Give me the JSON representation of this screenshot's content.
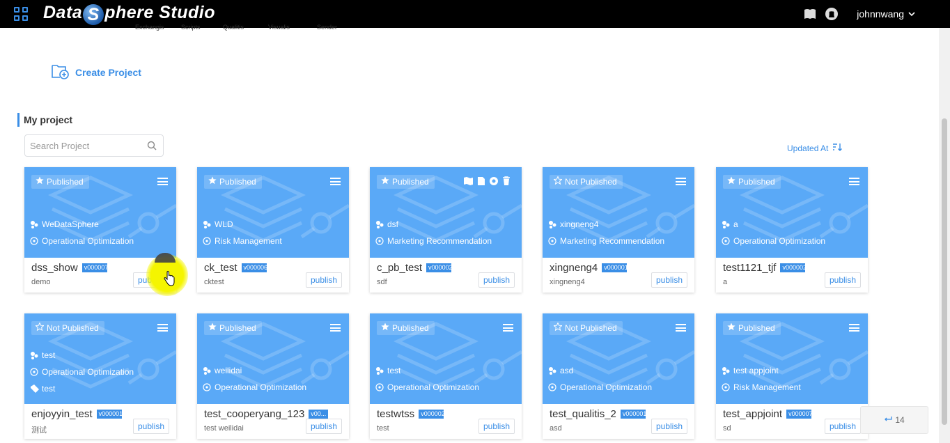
{
  "app": {
    "title_pre": "Data",
    "title_ball": "S",
    "title_post": "phere Studio",
    "user": "johnnwang"
  },
  "subnav": [
    "Exchangis",
    "Scripts",
    "Qualitis",
    "Visualis",
    "Sender"
  ],
  "create_label": "Create Project",
  "section_title": "My project",
  "search": {
    "placeholder": "Search Project"
  },
  "sort_label": "Updated At",
  "publish_label": "publish",
  "float_label": "14",
  "colors": {
    "accent": "#3a8ee6",
    "card_top": "#5aa9f7",
    "topbar": "#000000"
  },
  "projects": [
    {
      "status": "Published",
      "starred": true,
      "info": [
        {
          "icon": "users",
          "text": "WeDataSphere"
        },
        {
          "icon": "tag",
          "text": "Operational Optimization"
        }
      ],
      "name": "dss_show",
      "version": "v000007",
      "desc": "demo",
      "tools": false
    },
    {
      "status": "Published",
      "starred": true,
      "info": [
        {
          "icon": "users",
          "text": "WLD"
        },
        {
          "icon": "tag",
          "text": "Risk Management"
        }
      ],
      "name": "ck_test",
      "version": "v000006",
      "desc": "cktest",
      "tools": false
    },
    {
      "status": "Published",
      "starred": true,
      "info": [
        {
          "icon": "users",
          "text": "dsf"
        },
        {
          "icon": "tag",
          "text": "Marketing Recommendation"
        }
      ],
      "name": "c_pb_test",
      "version": "v000002",
      "desc": "sdf",
      "tools": true
    },
    {
      "status": "Not Published",
      "starred": false,
      "info": [
        {
          "icon": "users",
          "text": "xingneng4"
        },
        {
          "icon": "tag",
          "text": "Marketing Recommendation"
        }
      ],
      "name": "xingneng4",
      "version": "v000001",
      "desc": "xingneng4",
      "tools": false
    },
    {
      "status": "Published",
      "starred": true,
      "info": [
        {
          "icon": "users",
          "text": "a"
        },
        {
          "icon": "tag",
          "text": "Operational Optimization"
        }
      ],
      "name": "test1121_tjf",
      "version": "v000002",
      "desc": "a",
      "tools": false
    },
    {
      "status": "Not Published",
      "starred": false,
      "info": [
        {
          "icon": "users",
          "text": "test"
        },
        {
          "icon": "tag",
          "text": "Operational Optimization"
        },
        {
          "icon": "label",
          "text": "test"
        }
      ],
      "name": "enjoyyin_test",
      "version": "v000001",
      "desc": "测试",
      "tools": false
    },
    {
      "status": "Published",
      "starred": true,
      "info": [
        {
          "icon": "users",
          "text": "weilidai"
        },
        {
          "icon": "tag",
          "text": "Operational Optimization"
        }
      ],
      "name": "test_cooperyang_123",
      "version": "v00...",
      "desc": "test weilidai",
      "tools": false
    },
    {
      "status": "Published",
      "starred": true,
      "info": [
        {
          "icon": "users",
          "text": "test"
        },
        {
          "icon": "tag",
          "text": "Operational Optimization"
        }
      ],
      "name": "testwtss",
      "version": "v000002",
      "desc": "test",
      "tools": false
    },
    {
      "status": "Not Published",
      "starred": false,
      "info": [
        {
          "icon": "users",
          "text": "asd"
        },
        {
          "icon": "tag",
          "text": "Operational Optimization"
        }
      ],
      "name": "test_qualitis_2",
      "version": "v000001",
      "desc": "asd",
      "tools": false
    },
    {
      "status": "Published",
      "starred": true,
      "info": [
        {
          "icon": "users",
          "text": "test appjoint"
        },
        {
          "icon": "tag",
          "text": "Risk Management"
        }
      ],
      "name": "test_appjoint",
      "version": "v000007",
      "desc": "sd",
      "tools": false
    }
  ]
}
